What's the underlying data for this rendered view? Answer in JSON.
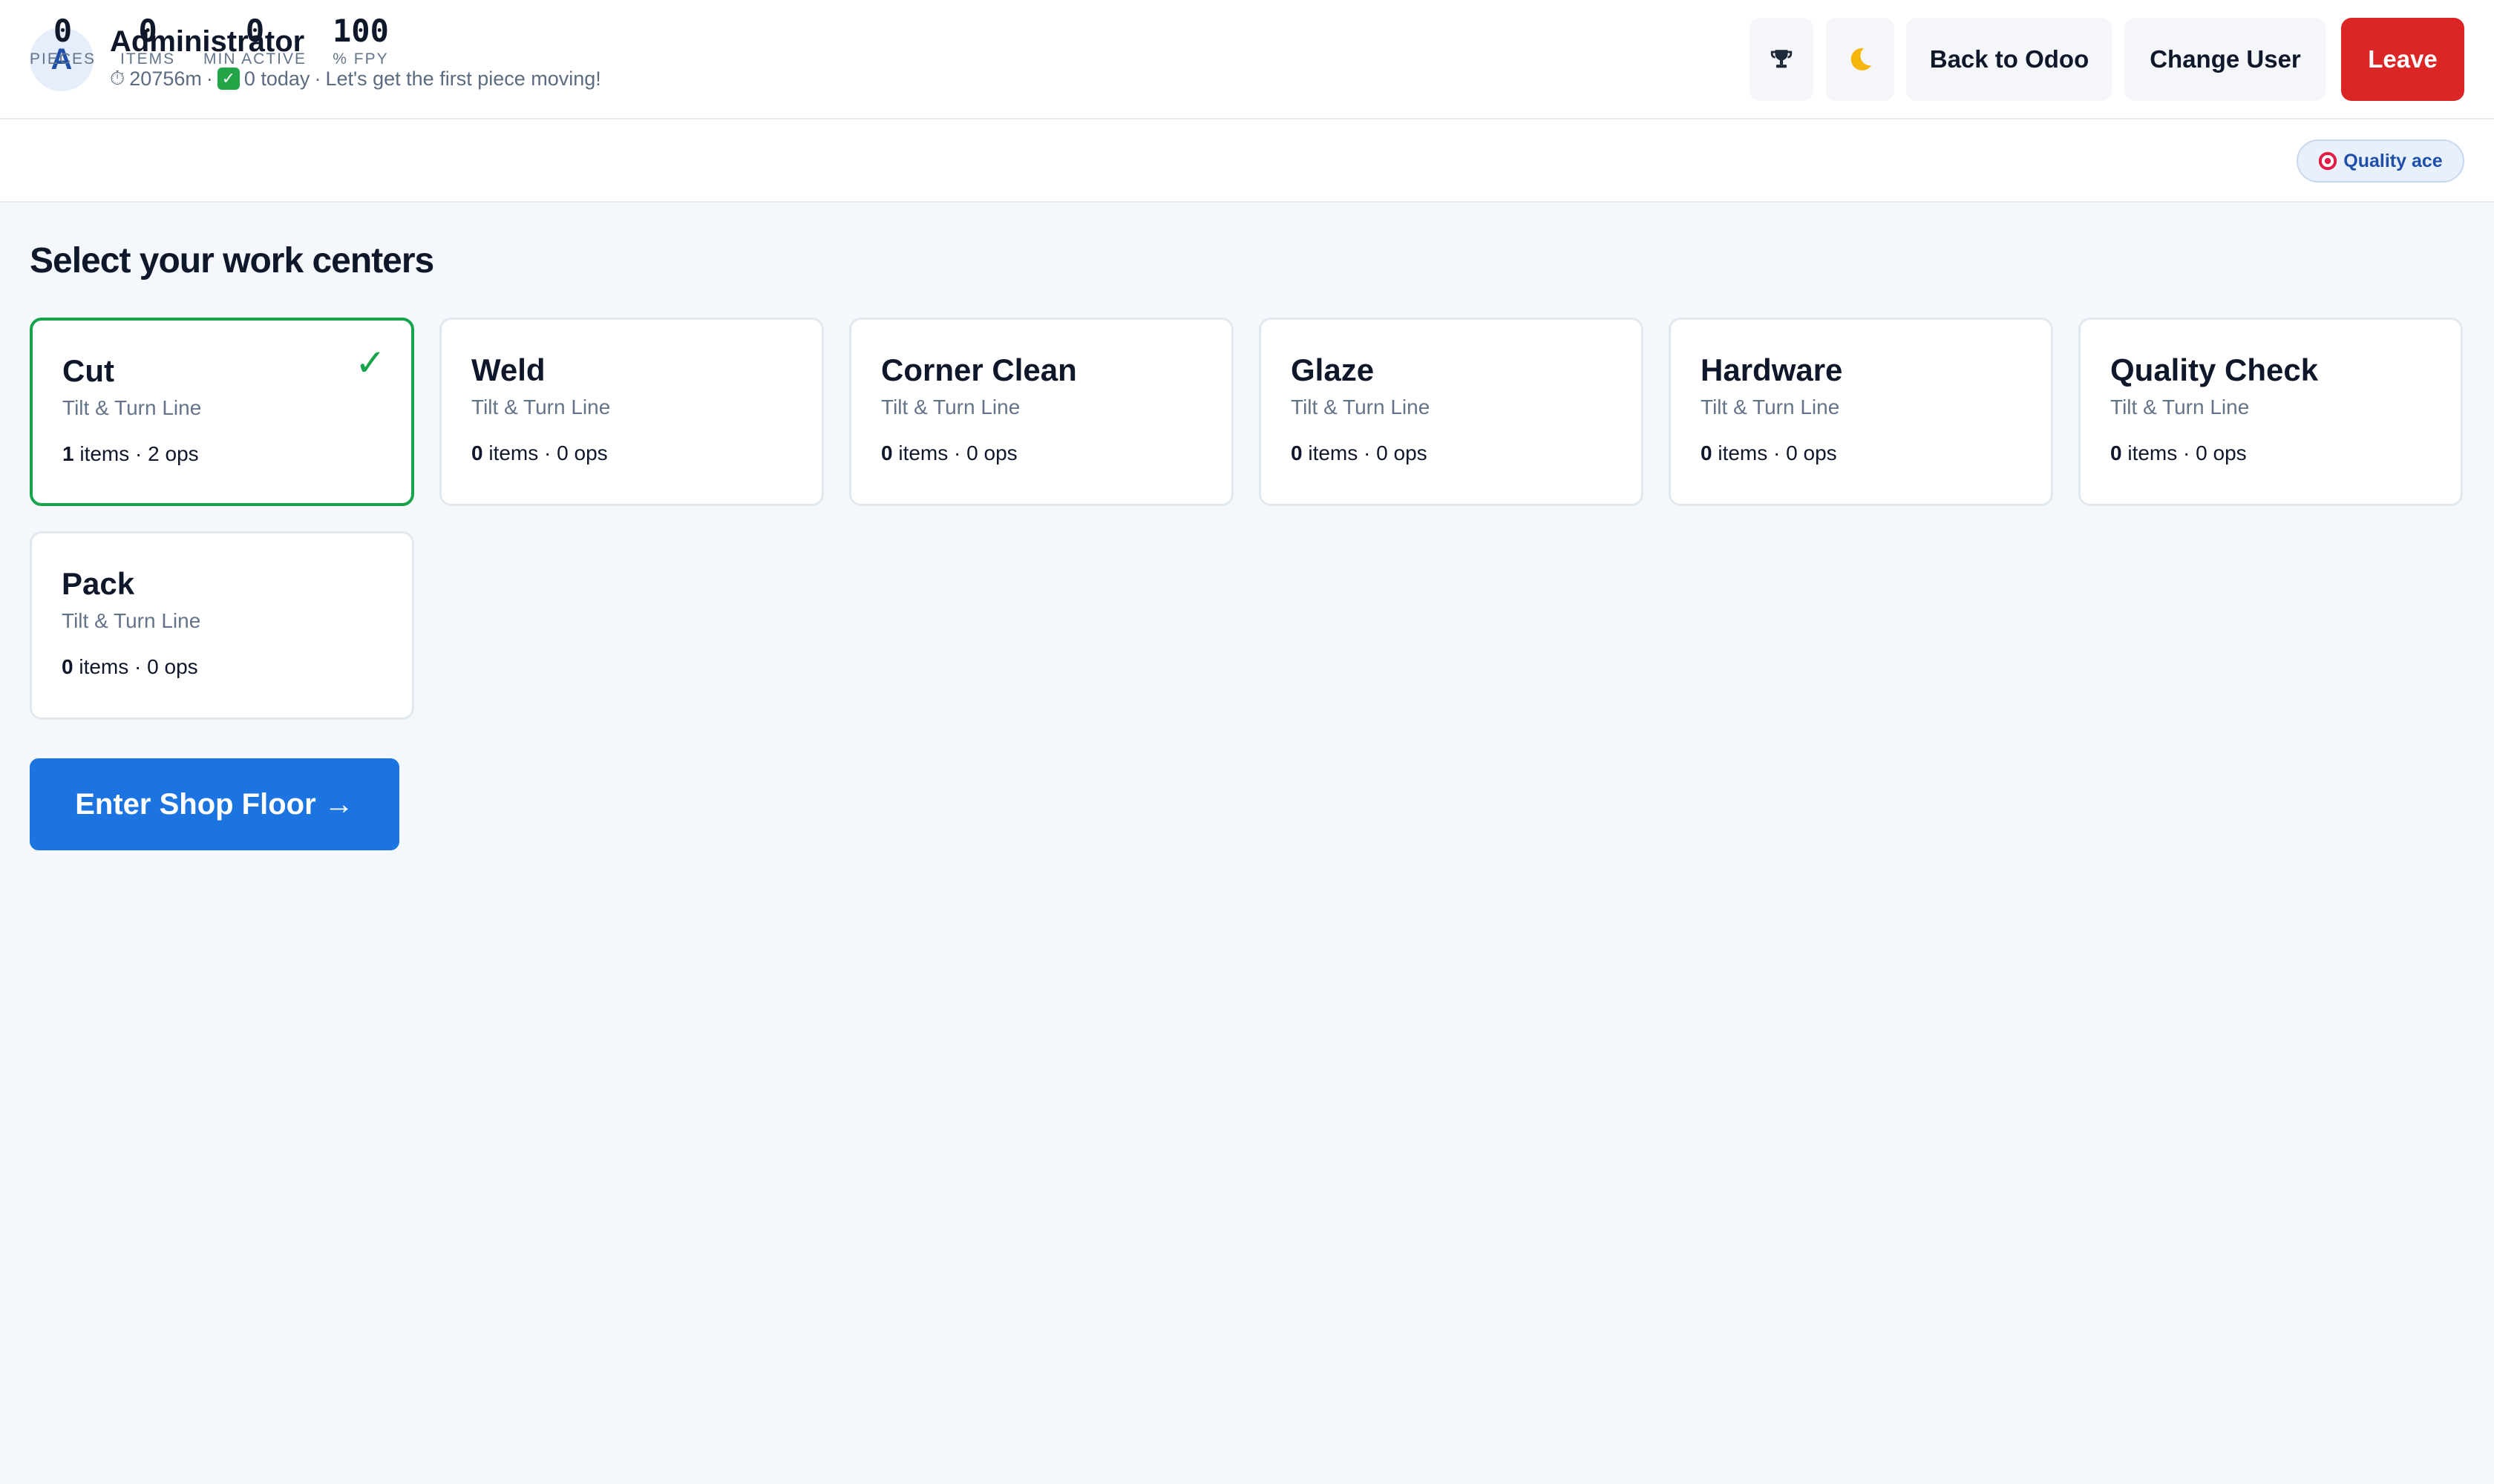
{
  "header": {
    "avatar_initial": "A",
    "user_name": "Administrator",
    "timer_icon": "stopwatch-icon",
    "timer": "20756m",
    "sep1": "·",
    "done_icon": "check-box-icon",
    "today": "0 today",
    "sep2": "·",
    "message": "Let's get the first piece moving!",
    "trophy_icon": "trophy-icon",
    "theme_icon": "moon-icon",
    "back_label": "Back to Odoo",
    "change_user_label": "Change User",
    "leave_label": "Leave",
    "leave_color": "#dc2626"
  },
  "stats": [
    {
      "value": "0",
      "label": "PIECES"
    },
    {
      "value": "0",
      "label": "ITEMS"
    },
    {
      "value": "0",
      "label": "MIN ACTIVE"
    },
    {
      "value": "100",
      "label": "% FPY"
    }
  ],
  "badge": {
    "icon": "target-icon",
    "label": "Quality ace"
  },
  "main": {
    "title": "Select your work centers",
    "work_centers": [
      {
        "name": "Cut",
        "line": "Tilt & Turn Line",
        "items": "1",
        "items_label": "items",
        "sep": "·",
        "ops": "2 ops",
        "selected": true,
        "check": "✓"
      },
      {
        "name": "Weld",
        "line": "Tilt & Turn Line",
        "items": "0",
        "items_label": "items",
        "sep": "·",
        "ops": "0 ops",
        "selected": false
      },
      {
        "name": "Corner Clean",
        "line": "Tilt & Turn Line",
        "items": "0",
        "items_label": "items",
        "sep": "·",
        "ops": "0 ops",
        "selected": false
      },
      {
        "name": "Glaze",
        "line": "Tilt & Turn Line",
        "items": "0",
        "items_label": "items",
        "sep": "·",
        "ops": "0 ops",
        "selected": false
      },
      {
        "name": "Hardware",
        "line": "Tilt & Turn Line",
        "items": "0",
        "items_label": "items",
        "sep": "·",
        "ops": "0 ops",
        "selected": false
      },
      {
        "name": "Quality Check",
        "line": "Tilt & Turn Line",
        "items": "0",
        "items_label": "items",
        "sep": "·",
        "ops": "0 ops",
        "selected": false
      },
      {
        "name": "Pack",
        "line": "Tilt & Turn Line",
        "items": "0",
        "items_label": "items",
        "sep": "·",
        "ops": "0 ops",
        "selected": false
      }
    ],
    "enter_label": "Enter Shop Floor →",
    "accent_color": "#1c74e0",
    "selected_color": "#16a34a"
  }
}
